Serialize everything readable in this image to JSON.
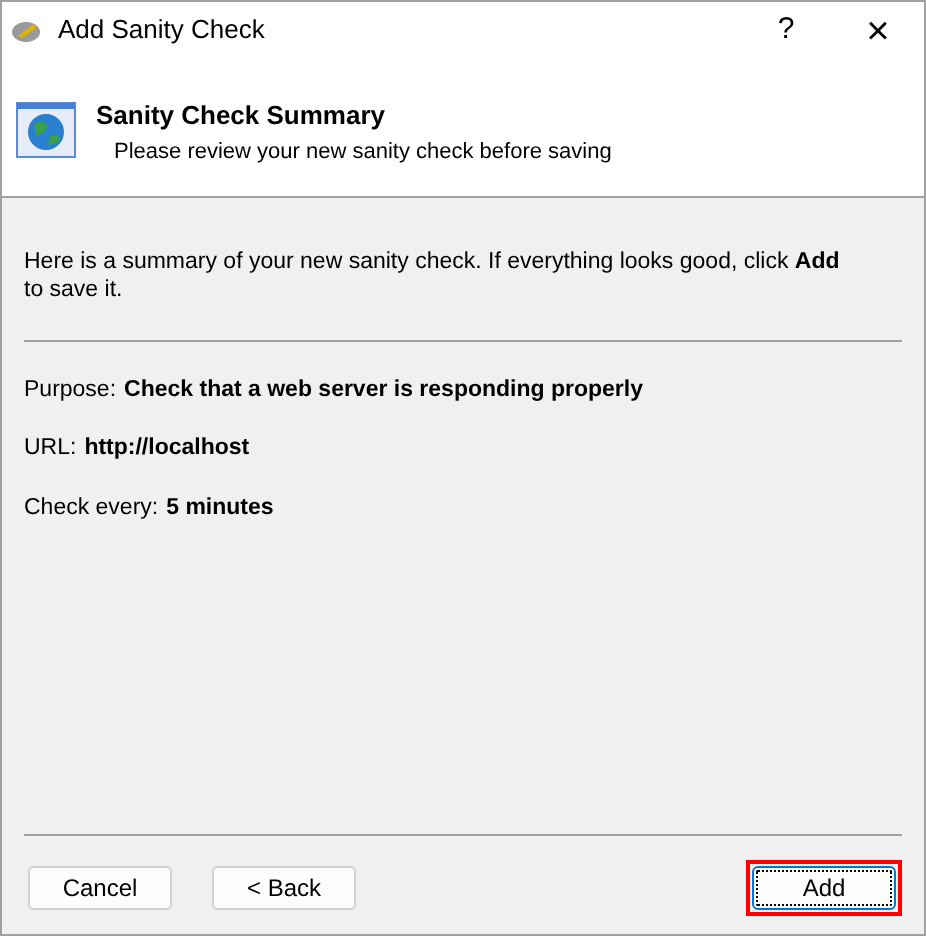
{
  "window": {
    "title": "Add Sanity Check",
    "help": "?",
    "close": "×"
  },
  "header": {
    "title": "Sanity Check Summary",
    "subtitle": "Please review your new sanity check before saving"
  },
  "intro": "Here is a summary of your new sanity check. If everything looks good, click **Add** to save it.",
  "details": [
    {
      "label": "Purpose:",
      "value": "Check that a web server is responding properly"
    },
    {
      "label": "URL:",
      "value": "http://localhost"
    },
    {
      "label": "Check every:",
      "value": "5 minutes"
    }
  ],
  "buttons": [
    {
      "label": "Cancel",
      "kind": "left",
      "highlighted": false
    },
    {
      "label": "< Back",
      "kind": "left",
      "highlighted": false
    },
    {
      "label": "Add",
      "kind": "right",
      "highlighted": true
    }
  ]
}
